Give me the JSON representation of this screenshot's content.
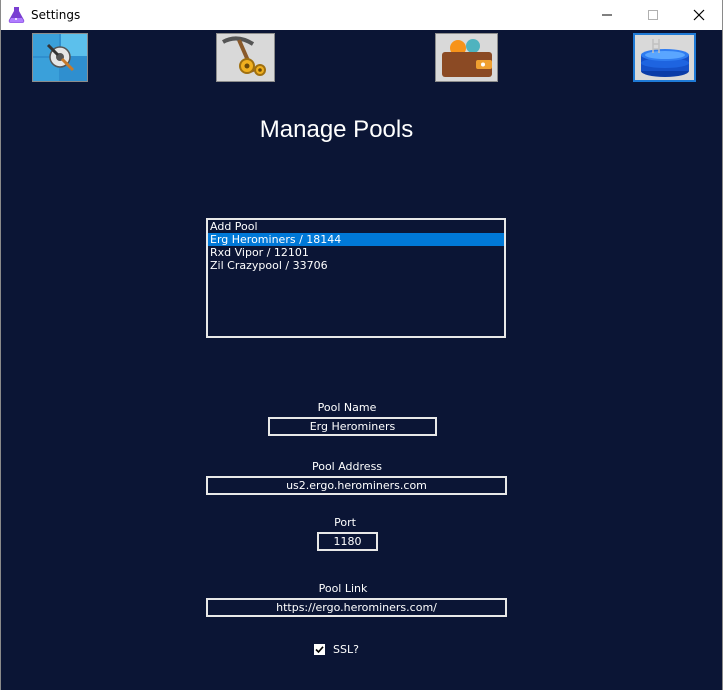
{
  "window": {
    "title": "Settings"
  },
  "nav": [
    {
      "name": "system-settings",
      "icon": "windows-settings-icon",
      "active": false
    },
    {
      "name": "mining",
      "icon": "pickaxe-gears-icon",
      "active": false
    },
    {
      "name": "wallet",
      "icon": "wallet-icon",
      "active": false
    },
    {
      "name": "pools",
      "icon": "pool-icon",
      "active": true
    }
  ],
  "page": {
    "heading": "Manage Pools"
  },
  "pool_list": {
    "items": [
      {
        "label": "Add Pool",
        "selected": false
      },
      {
        "label": "Erg Herominers / 18144",
        "selected": true
      },
      {
        "label": "Rxd Vipor / 12101",
        "selected": false
      },
      {
        "label": "Zil Crazypool / 33706",
        "selected": false
      }
    ]
  },
  "form": {
    "pool_name": {
      "label": "Pool Name",
      "value": "Erg Herominers"
    },
    "pool_address": {
      "label": "Pool Address",
      "value": "us2.ergo.herominers.com"
    },
    "port": {
      "label": "Port",
      "value": "1180"
    },
    "pool_link": {
      "label": "Pool Link",
      "value": "https://ergo.herominers.com/"
    },
    "ssl": {
      "label": "SSL?",
      "checked": true
    }
  },
  "colors": {
    "background": "#0b1535",
    "selection": "#0078d7",
    "active_border": "#1f7ad6"
  }
}
